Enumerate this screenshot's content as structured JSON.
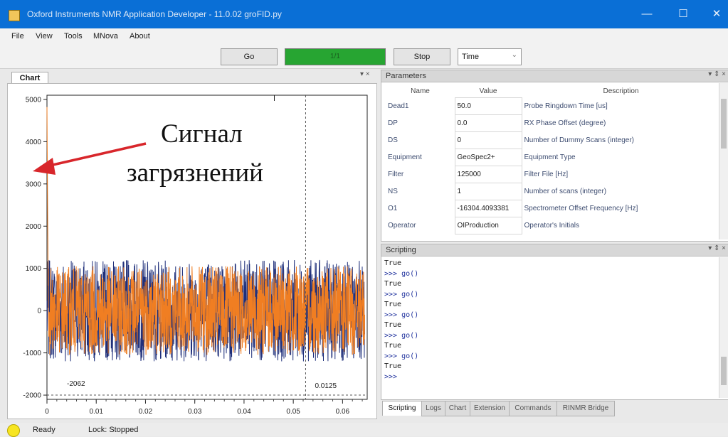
{
  "window": {
    "title": "Oxford Instruments NMR Application Developer - 11.0.02 groFID.py",
    "minimize": "—",
    "maximize": "☐",
    "close": "✕"
  },
  "menu": {
    "items": [
      "File",
      "View",
      "Tools",
      "MNova",
      "About"
    ]
  },
  "toolbar": {
    "go_label": "Go",
    "progress_text": "1/1",
    "progress_fraction": 1.0,
    "stop_label": "Stop",
    "mode_value": "Time"
  },
  "chart_panel": {
    "tab_label": "Chart",
    "controls": "▾ ×"
  },
  "chart_data": {
    "type": "line",
    "xlim": [
      0,
      0.065
    ],
    "ylim": [
      -2100,
      5100
    ],
    "x_ticks": [
      "0",
      "0.01",
      "0.02",
      "0.03",
      "0.04",
      "0.05",
      "0.06"
    ],
    "x_tick_values": [
      0,
      0.01,
      0.02,
      0.03,
      0.04,
      0.05,
      0.06
    ],
    "y_ticks": [
      "5000",
      "4000",
      "3000",
      "2000",
      "1000",
      "0",
      "-1000",
      "-2000"
    ],
    "y_tick_values": [
      5000,
      4000,
      3000,
      2000,
      1000,
      0,
      -1000,
      -2000
    ],
    "series": [
      {
        "color": "#1f2f7a",
        "amplitude": 1200
      },
      {
        "color": "#f07e22",
        "amplitude": 1050,
        "initial_spike": 4900
      }
    ],
    "cursor_x": 0.0525,
    "min_y": -2000,
    "annotations": {
      "min_label": "-2062",
      "cursor_label": "0.0125"
    }
  },
  "annotation": {
    "line1": "Сигнал",
    "line2": "загрязнений",
    "arrow_color": "#d8262b"
  },
  "parameters": {
    "title": "Parameters",
    "controls": "▾ ⇕ ×",
    "headers": {
      "name": "Name",
      "value": "Value",
      "description": "Description"
    },
    "rows": [
      {
        "name": "Dead1",
        "value": "50.0",
        "description": "Probe Ringdown Time [us]"
      },
      {
        "name": "DP",
        "value": "0.0",
        "description": "RX Phase Offset (degree)"
      },
      {
        "name": "DS",
        "value": "0",
        "description": "Number of Dummy Scans (integer)"
      },
      {
        "name": "Equipment",
        "value": "GeoSpec2+",
        "description": "Equipment Type"
      },
      {
        "name": "Filter",
        "value": "125000",
        "description": "Filter File [Hz]"
      },
      {
        "name": "NS",
        "value": "1",
        "description": "Number of scans (integer)"
      },
      {
        "name": "O1",
        "value": "-16304.4093381",
        "description": "Spectrometer Offset Frequency [Hz]"
      },
      {
        "name": "Operator",
        "value": "OIProduction",
        "description": "Operator's Initials"
      }
    ]
  },
  "scripting": {
    "title": "Scripting",
    "controls": "▾ ⇕ ×",
    "lines": [
      "True",
      ">>> go()",
      "True",
      ">>> go()",
      "True",
      ">>> go()",
      "True",
      ">>> go()",
      "True",
      ">>> go()",
      "True",
      ">>>"
    ]
  },
  "bottom_tabs": [
    "Scripting",
    "Logs",
    "Chart",
    "Extension",
    "Commands",
    "RINMR Bridge"
  ],
  "status": {
    "ready": "Ready",
    "lock": "Lock: Stopped",
    "light_color": "#f7e521"
  }
}
